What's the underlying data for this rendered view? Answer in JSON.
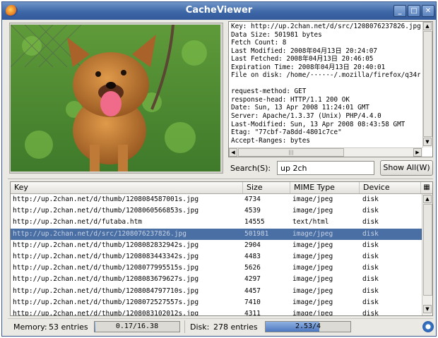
{
  "window": {
    "title": "CacheViewer"
  },
  "details": {
    "lines": [
      "Key: http://up.2chan.net/d/src/1208076237826.jpg",
      "Data Size: 501981 bytes",
      "Fetch Count: 8",
      "Last Modified: 2008年04月13日 20:24:07",
      "Last Fetched: 2008年04月13日 20:46:05",
      "Expiration Time: 2008年04月13日 20:40:01",
      "File on disk: /home/·····-/.mozilla/firefox/q34r",
      "",
      "request-method: GET",
      "response-head: HTTP/1.1 200 OK",
      "Date: Sun, 13 Apr 2008 11:24:01 GMT",
      "Server: Apache/1.3.37 (Unix) PHP/4.4.0",
      "Last-Modified: Sun, 13 Apr 2008 08:43:58 GMT",
      "Etag: \"77cbf-7a8dd-4801c7ce\"",
      "Accept-Ranges: bytes"
    ],
    "hscroll_grip": "|||"
  },
  "search": {
    "label": "Search(S):",
    "value": "up 2ch"
  },
  "show_all_label": "Show All(W)",
  "table": {
    "headers": {
      "key": "Key",
      "size": "Size",
      "mime": "MIME Type",
      "device": "Device"
    },
    "rows": [
      {
        "key": "http://up.2chan.net/d/thumb/1208084587001s.jpg",
        "size": "4734",
        "mime": "image/jpeg",
        "device": "disk",
        "selected": false
      },
      {
        "key": "http://up.2chan.net/d/thumb/1208060566853s.jpg",
        "size": "4539",
        "mime": "image/jpeg",
        "device": "disk",
        "selected": false
      },
      {
        "key": "http://up.2chan.net/d/futaba.htm",
        "size": "14555",
        "mime": "text/html",
        "device": "disk",
        "selected": false
      },
      {
        "key": "http://up.2chan.net/d/src/1208076237826.jpg",
        "size": "501981",
        "mime": "image/jpeg",
        "device": "disk",
        "selected": true
      },
      {
        "key": "http://up.2chan.net/d/thumb/1208082832942s.jpg",
        "size": "2904",
        "mime": "image/jpeg",
        "device": "disk",
        "selected": false
      },
      {
        "key": "http://up.2chan.net/d/thumb/1208083443342s.jpg",
        "size": "4483",
        "mime": "image/jpeg",
        "device": "disk",
        "selected": false
      },
      {
        "key": "http://up.2chan.net/d/thumb/1208077995515s.jpg",
        "size": "5626",
        "mime": "image/jpeg",
        "device": "disk",
        "selected": false
      },
      {
        "key": "http://up.2chan.net/d/thumb/1208083679627s.jpg",
        "size": "4297",
        "mime": "image/jpeg",
        "device": "disk",
        "selected": false
      },
      {
        "key": "http://up.2chan.net/d/thumb/1208084797710s.jpg",
        "size": "4457",
        "mime": "image/jpeg",
        "device": "disk",
        "selected": false
      },
      {
        "key": "http://up.2chan.net/d/thumb/1208072527557s.jpg",
        "size": "7410",
        "mime": "image/jpeg",
        "device": "disk",
        "selected": false
      },
      {
        "key": "http://up.2chan.net/d/thumb/1208083102012s.jpg",
        "size": "4311",
        "mime": "image/jpeg",
        "device": "disk",
        "selected": false
      }
    ]
  },
  "status": {
    "memory_label": "Memory:",
    "memory_entries": "53 entries",
    "memory_usage": "0.17/16.38",
    "memory_fraction": 0.0104,
    "disk_label": "Disk:",
    "disk_entries": "278 entries",
    "disk_usage": "2.53/4",
    "disk_fraction": 0.6325
  },
  "colors": {
    "titlebar": "#3d67a6",
    "selection": "#4a6fa5",
    "progress": "#4d78bf"
  },
  "icons": {
    "app": "firefox-icon",
    "refresh": "refresh-icon",
    "column_picker": "column-picker-icon"
  }
}
